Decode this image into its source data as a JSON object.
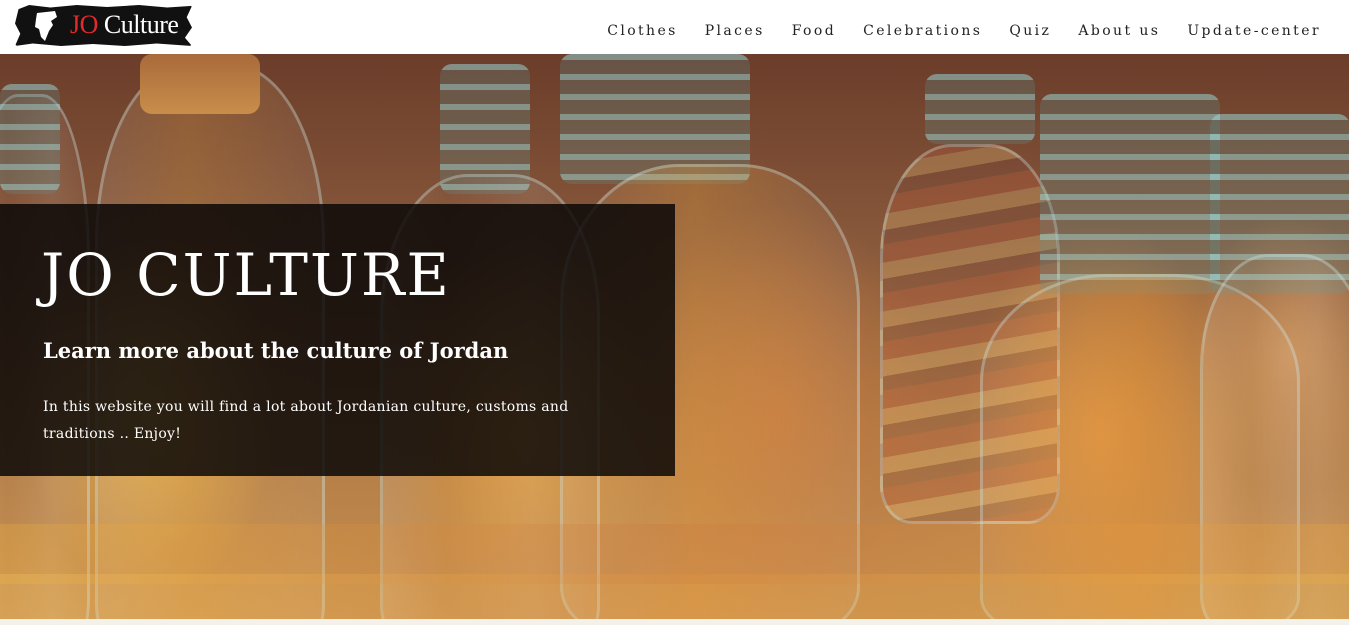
{
  "header": {
    "logo": {
      "prefix": "JO",
      "suffix": " Culture"
    },
    "nav": [
      {
        "label": "Clothes"
      },
      {
        "label": "Places"
      },
      {
        "label": "Food"
      },
      {
        "label": "Celebrations"
      },
      {
        "label": "Quiz"
      },
      {
        "label": "About us"
      },
      {
        "label": "Update-center"
      }
    ]
  },
  "hero": {
    "title": "JO CULTURE",
    "subtitle": "Learn more about the culture of Jordan",
    "description": "In this website you will find a lot about Jordanian culture, customs and traditions .. Enjoy!",
    "background_image": "sand-bottles-icon"
  },
  "colors": {
    "header_bg": "#ffffff",
    "nav_text": "#222222",
    "logo_accent": "#e42a2a",
    "overlay_bg": "rgba(8,6,6,0.84)",
    "hero_text": "#ffffff"
  }
}
